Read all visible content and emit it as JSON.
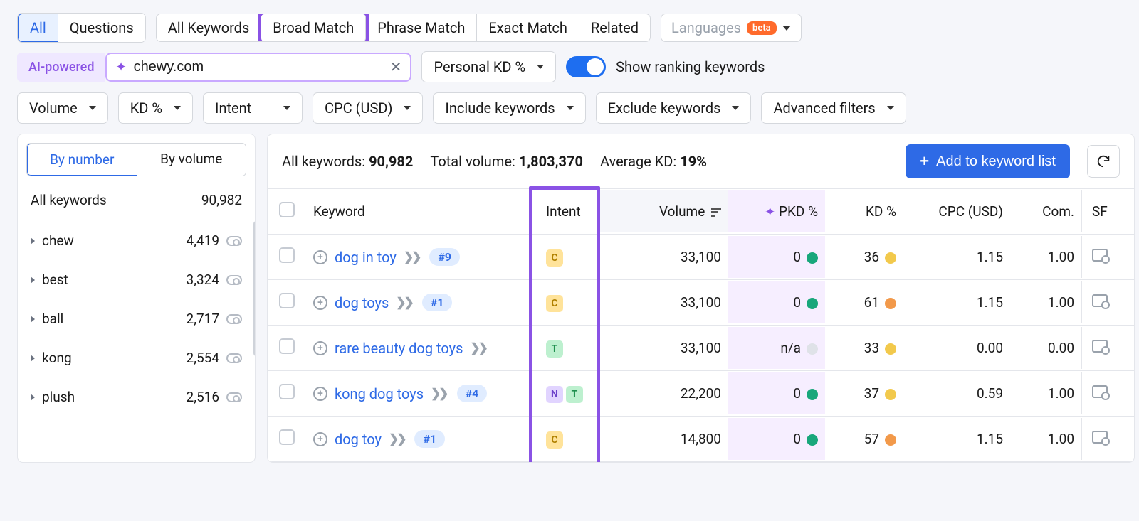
{
  "tabs1": {
    "all": "All",
    "questions": "Questions"
  },
  "tabs2": {
    "all_kw": "All Keywords",
    "broad": "Broad Match",
    "phrase": "Phrase Match",
    "exact": "Exact Match",
    "related": "Related"
  },
  "languages": {
    "label": "Languages",
    "beta": "beta"
  },
  "ai_label": "AI-powered",
  "domain_input": "chewy.com",
  "personal_kd": "Personal KD %",
  "show_ranking": "Show ranking keywords",
  "filters": {
    "volume": "Volume",
    "kd": "KD %",
    "intent": "Intent",
    "cpc": "CPC (USD)",
    "include": "Include keywords",
    "exclude": "Exclude keywords",
    "advanced": "Advanced filters"
  },
  "sidebar": {
    "by_number": "By number",
    "by_volume": "By volume",
    "all_label": "All keywords",
    "all_count": "90,982",
    "items": [
      {
        "term": "chew",
        "count": "4,419"
      },
      {
        "term": "best",
        "count": "3,324"
      },
      {
        "term": "ball",
        "count": "2,717"
      },
      {
        "term": "kong",
        "count": "2,554"
      },
      {
        "term": "plush",
        "count": "2,516"
      }
    ]
  },
  "stats": {
    "all_kw_label": "All keywords:",
    "all_kw_val": "90,982",
    "tot_vol_label": "Total volume:",
    "tot_vol_val": "1,803,370",
    "avg_kd_label": "Average KD:",
    "avg_kd_val": "19%"
  },
  "add_button": "Add to keyword list",
  "columns": {
    "keyword": "Keyword",
    "intent": "Intent",
    "volume": "Volume",
    "pkd": "PKD %",
    "kd": "KD %",
    "cpc": "CPC (USD)",
    "com": "Com.",
    "sf": "SF"
  },
  "rows": [
    {
      "kw": "dog in toy",
      "rank": "#9",
      "intent": [
        "C"
      ],
      "volume": "33,100",
      "pkd": "0",
      "pkd_dot": "green",
      "kd": "36",
      "kd_dot": "yellow",
      "cpc": "1.15",
      "com": "1.00"
    },
    {
      "kw": "dog toys",
      "rank": "#1",
      "intent": [
        "C"
      ],
      "volume": "33,100",
      "pkd": "0",
      "pkd_dot": "green",
      "kd": "61",
      "kd_dot": "orange",
      "cpc": "1.15",
      "com": "1.00"
    },
    {
      "kw": "rare beauty dog toys",
      "rank": "",
      "intent": [
        "T"
      ],
      "volume": "33,100",
      "pkd": "n/a",
      "pkd_dot": "grey",
      "kd": "33",
      "kd_dot": "yellow",
      "cpc": "0.00",
      "com": "0.00"
    },
    {
      "kw": "kong dog toys",
      "rank": "#4",
      "intent": [
        "N",
        "T"
      ],
      "volume": "22,200",
      "pkd": "0",
      "pkd_dot": "green",
      "kd": "37",
      "kd_dot": "yellow",
      "cpc": "0.59",
      "com": "1.00"
    },
    {
      "kw": "dog toy",
      "rank": "#1",
      "intent": [
        "C"
      ],
      "volume": "14,800",
      "pkd": "0",
      "pkd_dot": "green",
      "kd": "57",
      "kd_dot": "orange",
      "cpc": "1.15",
      "com": "1.00"
    }
  ]
}
